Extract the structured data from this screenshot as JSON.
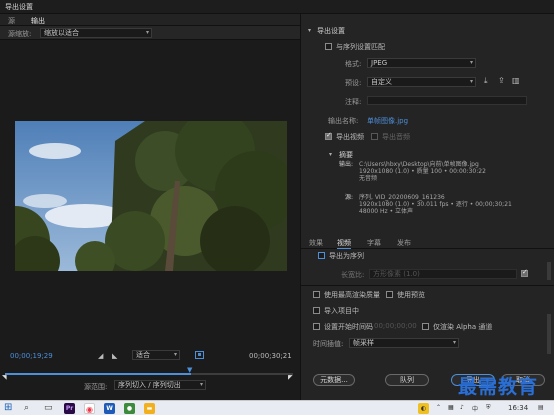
{
  "window": {
    "title": "导出设置"
  },
  "left_tabs": [
    {
      "label": "源"
    },
    {
      "label": "输出"
    }
  ],
  "source_scaling": {
    "label": "源缩放:",
    "value": "缩放以适合"
  },
  "timecodes": {
    "current": "00;00;19;29",
    "duration": "00;00;30;21"
  },
  "fit_select": {
    "value": "适合"
  },
  "source_range": {
    "label": "源范围:",
    "value": "序列切入 / 序列切出"
  },
  "export_settings": {
    "section_title": "导出设置",
    "match_sequence": {
      "label": "与序列设置匹配",
      "checked": false
    },
    "format": {
      "label": "格式:",
      "value": "JPEG"
    },
    "preset": {
      "label": "预设:",
      "value": "自定义"
    },
    "comments": {
      "label": "注释:",
      "value": ""
    },
    "output_name": {
      "label": "输出名称:",
      "value": "单帧图像.jpg"
    },
    "export_video": {
      "label": "导出视频",
      "checked": true
    },
    "export_audio": {
      "label": "导出音频",
      "checked": false
    }
  },
  "summary": {
    "title": "摘要",
    "output_label": "输出:",
    "output_lines": [
      "C:\\Users\\hbxy\\Desktop\\向前\\单帧图像.jpg",
      "1920x1080 (1.0) • 质量 100 • 00:00:30:22",
      "无音频"
    ],
    "source_label": "源:",
    "source_lines": [
      "序列, VID_20200609_161236",
      "1920x1080 (1.0) • 30.011 fps • 逐行 • 00;00;30;21",
      "48000 Hz • 立体声"
    ]
  },
  "settings_tabs": [
    {
      "label": "效果"
    },
    {
      "label": "视频"
    },
    {
      "label": "字幕"
    },
    {
      "label": "发布"
    }
  ],
  "video_panel": {
    "export_as_sequence": {
      "label": "导出为序列",
      "checked": false
    },
    "aspect_label": "长宽比:",
    "aspect_value": "方形像素 (1.0)"
  },
  "options": {
    "max_render_quality": "使用最高渲染质量",
    "use_previews": "使用预览",
    "import_into_project": "导入项目中",
    "set_start_timecode": "设置开始时间码",
    "start_timecode_value": "00;00;00;00",
    "render_alpha_only": "仅渲染 Alpha 通道",
    "time_interpolation_label": "时间插值:",
    "time_interpolation_value": "帧采样"
  },
  "buttons": {
    "metadata": "元数据...",
    "queue": "队列",
    "export": "导出",
    "cancel": "取消"
  },
  "watermark": "最需教育",
  "taskbar": {
    "clock": "16:34",
    "lang": "中",
    "app_icons": [
      "Pr",
      "W"
    ]
  }
}
